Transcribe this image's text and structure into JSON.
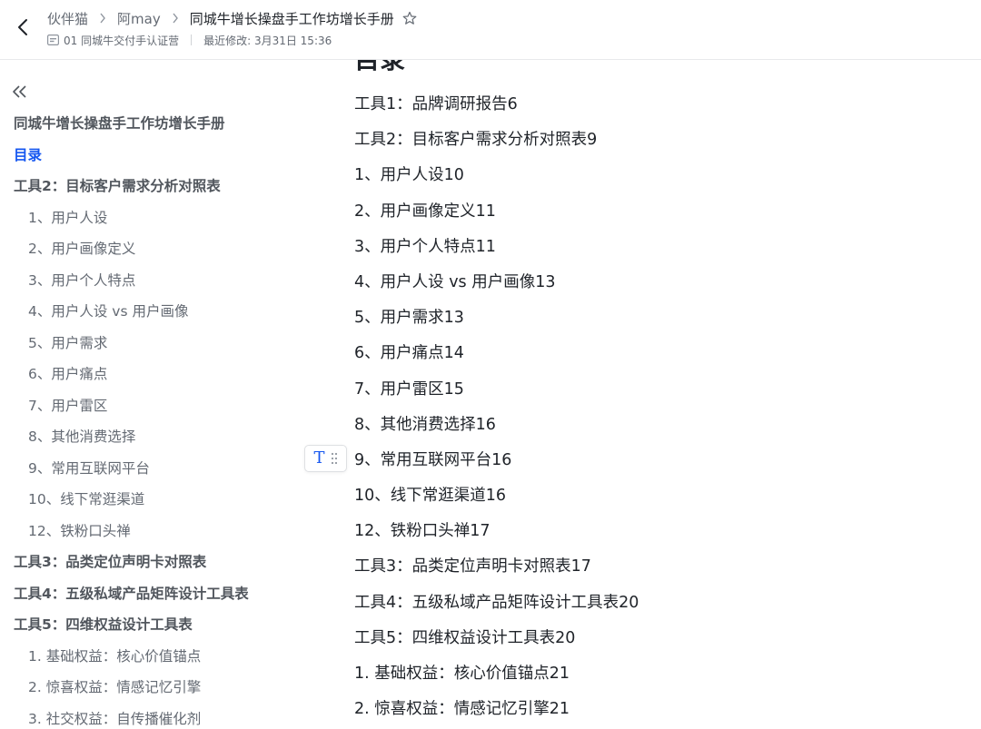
{
  "header": {
    "breadcrumbs": [
      "伙伴猫",
      "阿may",
      "同城牛增长操盘手工作坊增长手册"
    ],
    "folder": "01 同城牛交付手认证营",
    "modified": "最近修改: 3月31日 15:36"
  },
  "sidebar": {
    "items": [
      {
        "label": "同城牛增长操盘手工作坊增长手册",
        "level": 1
      },
      {
        "label": "目录",
        "level": 1,
        "active": true
      },
      {
        "label": "工具2：目标客户需求分析对照表",
        "level": 1
      },
      {
        "label": "1、用户人设",
        "level": 2
      },
      {
        "label": "2、用户画像定义",
        "level": 2
      },
      {
        "label": "3、用户个人特点",
        "level": 2
      },
      {
        "label": "4、用户人设 vs 用户画像",
        "level": 2
      },
      {
        "label": "5、用户需求",
        "level": 2
      },
      {
        "label": "6、用户痛点",
        "level": 2
      },
      {
        "label": "7、用户雷区",
        "level": 2
      },
      {
        "label": "8、其他消费选择",
        "level": 2
      },
      {
        "label": "9、常用互联网平台",
        "level": 2
      },
      {
        "label": "10、线下常逛渠道",
        "level": 2
      },
      {
        "label": "12、铁粉口头禅",
        "level": 2
      },
      {
        "label": "工具3：品类定位声明卡对照表",
        "level": 1
      },
      {
        "label": "工具4：五级私域产品矩阵设计工具表",
        "level": 1
      },
      {
        "label": "工具5：四维权益设计工具表",
        "level": 1
      },
      {
        "label": "1. 基础权益：核心价值锚点",
        "level": 2
      },
      {
        "label": "2. 惊喜权益：情感记忆引擎",
        "level": 2
      },
      {
        "label": "3. 社交权益：自传播催化剂",
        "level": 2
      }
    ]
  },
  "floating_toolbar": {
    "text_icon": "T"
  },
  "content": {
    "heading": "目录",
    "lines": [
      "工具1：品牌调研报告6",
      "工具2：目标客户需求分析对照表9",
      "1、用户人设10",
      "2、用户画像定义11",
      "3、用户个人特点11",
      "4、用户人设 vs 用户画像13",
      "5、用户需求13",
      "6、用户痛点14",
      "7、用户雷区15",
      "8、其他消费选择16",
      "9、常用互联网平台16",
      "10、线下常逛渠道16",
      "12、铁粉口头禅17",
      "工具3：品类定位声明卡对照表17",
      "工具4：五级私域产品矩阵设计工具表20",
      "工具5：四维权益设计工具表20",
      "1. 基础权益：核心价值锚点21",
      "2. 惊喜权益：情感记忆引擎21"
    ]
  },
  "colors": {
    "accent": "#1456f0",
    "text": "#1f2329",
    "muted": "#646a73"
  },
  "icons": [
    "back-arrow-icon",
    "chevron-right-icon",
    "star-icon",
    "folder-icon",
    "collapse-double-chevron-icon",
    "text-format-icon",
    "drag-handle-icon"
  ]
}
